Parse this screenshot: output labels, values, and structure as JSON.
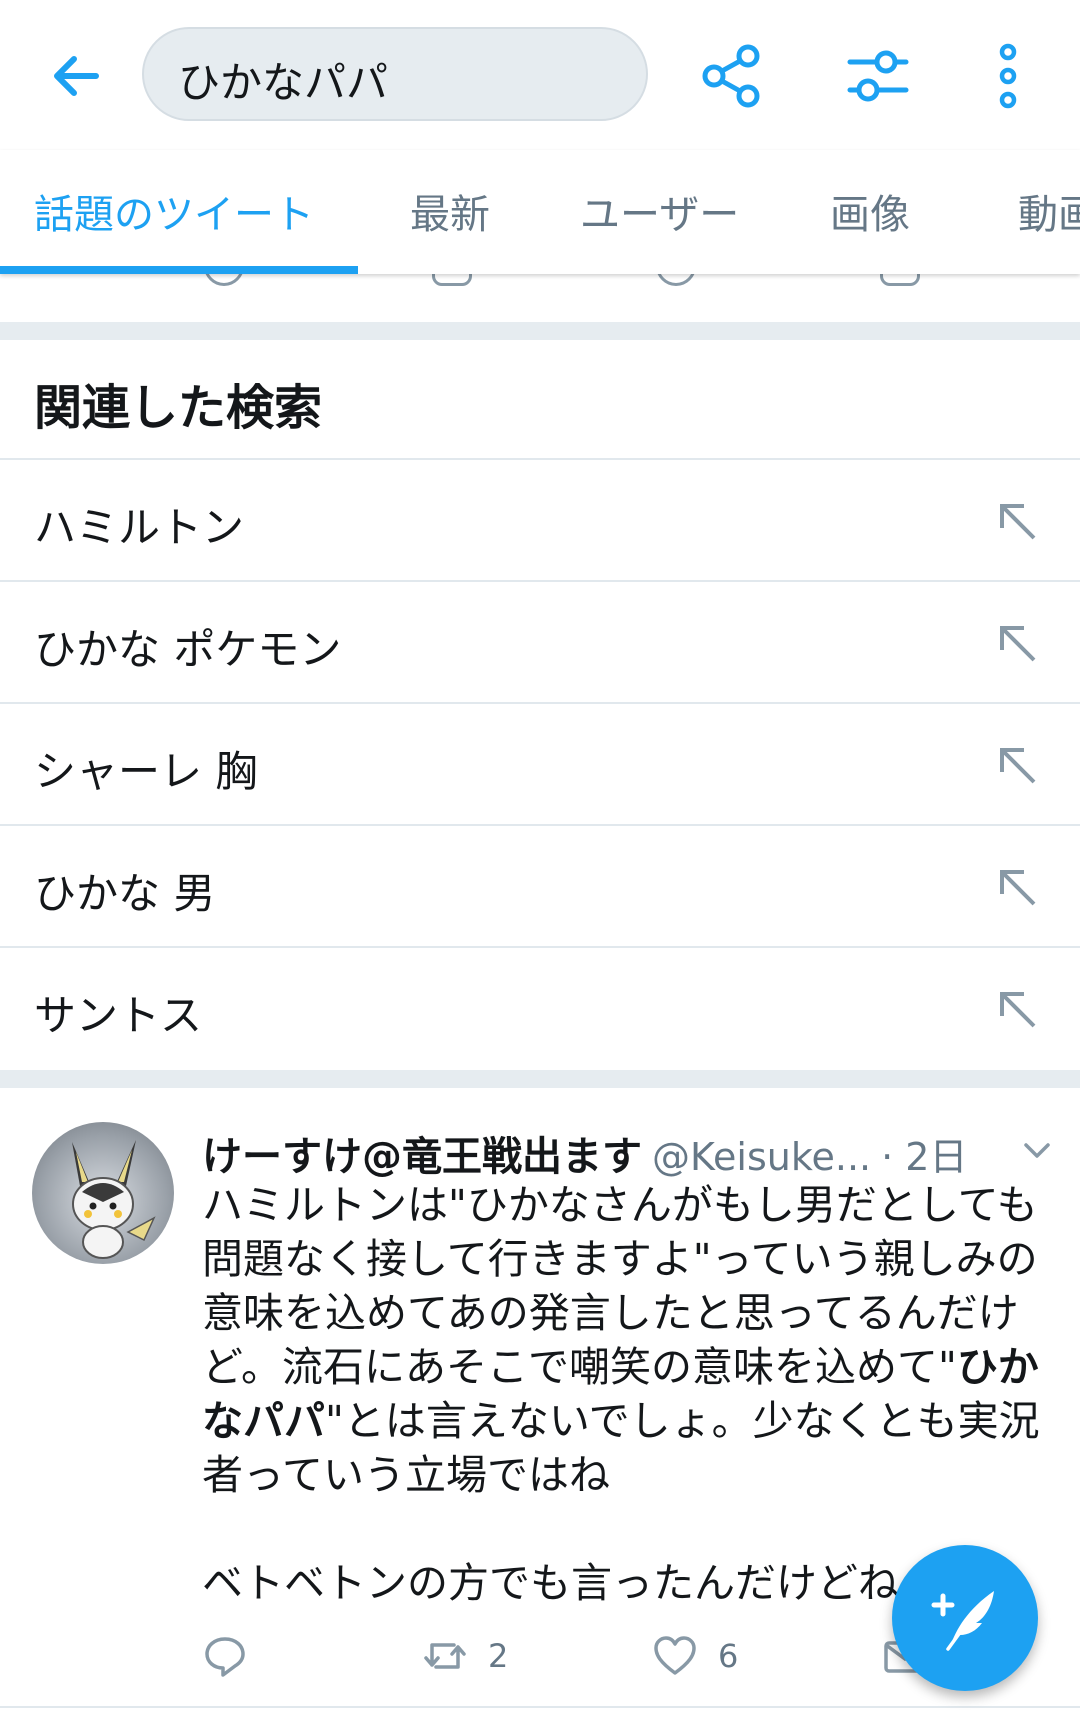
{
  "search": {
    "query": "ひかなパパ"
  },
  "tabs": [
    {
      "label": "話題のツイート"
    },
    {
      "label": "最新"
    },
    {
      "label": "ユーザー"
    },
    {
      "label": "画像"
    },
    {
      "label": "動画"
    }
  ],
  "related": {
    "title": "関連した検索",
    "items": [
      {
        "label": "ハミルトン"
      },
      {
        "label": "ひかな ポケモン"
      },
      {
        "label": "シャーレ 胸"
      },
      {
        "label": "ひかな 男"
      },
      {
        "label": "サントス"
      }
    ]
  },
  "tweet": {
    "name": "けーすけ@竜王戦出ます",
    "handle": "@Keisuke...",
    "time": "· 2日",
    "text_part1": "ハミルトンは\"ひかなさんがもし男だとしても問題なく接して行きますよ\"っていう親しみの意味を込めてあの発言したと思ってるんだけど。流石にあそこで嘲笑の意味を込めて\"",
    "text_bold": "ひかなパパ",
    "text_part2": "\"とは言えないでしょ。少なくとも実況者っていう立場ではね",
    "text_part3": "ベトベトンの方でも言ったんだけどね",
    "retweet_count": "2",
    "like_count": "6"
  },
  "colors": {
    "accent": "#1da1f2",
    "secondary_text": "#657786",
    "divider": "#e6ecf0"
  },
  "icons": {
    "back": "arrow-left-icon",
    "share": "share-icon",
    "filter": "sliders-icon",
    "more": "more-vertical-icon",
    "arrow": "arrow-up-left-icon",
    "compose": "compose-feather-icon"
  }
}
